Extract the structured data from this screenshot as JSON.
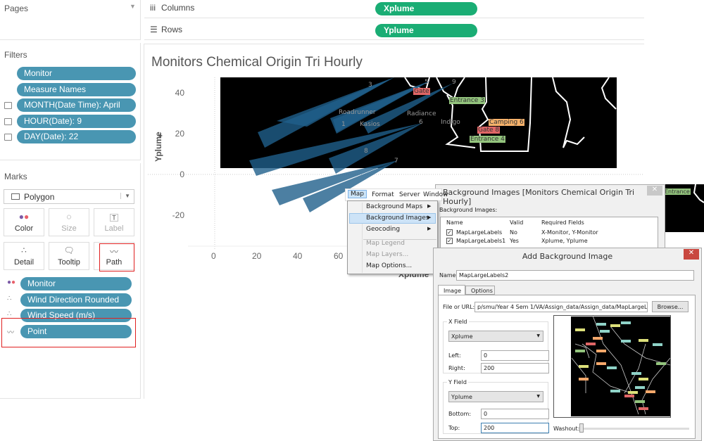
{
  "pages": {
    "title": "Pages"
  },
  "filters": {
    "title": "Filters",
    "items": [
      {
        "label": "Monitor",
        "icon": ""
      },
      {
        "label": "Measure Names",
        "icon": ""
      },
      {
        "label": "MONTH(Date Time): April",
        "icon": "filter-icon"
      },
      {
        "label": "HOUR(Date): 9",
        "icon": "filter-icon"
      },
      {
        "label": "DAY(Date): 22",
        "icon": "filter-icon"
      }
    ]
  },
  "marks": {
    "title": "Marks",
    "type": "Polygon",
    "buttons": [
      {
        "label": "Color",
        "icon": "color-icon",
        "enabled": true
      },
      {
        "label": "Size",
        "icon": "size-icon",
        "enabled": false
      },
      {
        "label": "Label",
        "icon": "label-icon",
        "enabled": false
      },
      {
        "label": "Detail",
        "icon": "detail-icon",
        "enabled": true
      },
      {
        "label": "Tooltip",
        "icon": "tooltip-icon",
        "enabled": true
      },
      {
        "label": "Path",
        "icon": "path-icon",
        "enabled": true
      }
    ],
    "fields": [
      {
        "label": "Monitor",
        "icon": "color-icon"
      },
      {
        "label": "Wind Direction Rounded",
        "icon": "detail-icon"
      },
      {
        "label": "Wind Speed (m/s)",
        "icon": "detail-icon"
      },
      {
        "label": "Point",
        "icon": "path-icon"
      }
    ]
  },
  "shelves": {
    "columns_label": "Columns",
    "columns_pill": "Xplume",
    "rows_label": "Rows",
    "rows_pill": "Yplume"
  },
  "sheet": {
    "title": "Monitors Chemical Origin Tri Hourly",
    "ylabel": "Yplume",
    "xlabel": "Xplume",
    "xticks": [
      "0",
      "20",
      "40",
      "60"
    ],
    "yticks": [
      "40",
      "20",
      "0",
      "-20"
    ],
    "mark_color": "#1f5f8b",
    "map_labels": [
      {
        "t": "Gate",
        "c": "#e06666"
      },
      {
        "t": "Entrance 3",
        "c": "#93c47d"
      },
      {
        "t": "Roadrunner",
        "c": ""
      },
      {
        "t": "Radiance",
        "c": ""
      },
      {
        "t": "Kasios",
        "c": ""
      },
      {
        "t": "Indigo",
        "c": ""
      },
      {
        "t": "Camping 6",
        "c": "#f6b26b"
      },
      {
        "t": "Gate 8",
        "c": "#e06666"
      },
      {
        "t": "Entrance 4",
        "c": "#93c47d"
      },
      {
        "t": "3",
        "c": ""
      },
      {
        "t": "5",
        "c": ""
      },
      {
        "t": "9",
        "c": ""
      },
      {
        "t": "1",
        "c": ""
      },
      {
        "t": "6",
        "c": ""
      },
      {
        "t": "8",
        "c": ""
      },
      {
        "t": "7",
        "c": ""
      },
      {
        "t": "Entrance",
        "c": "#93c47d"
      }
    ]
  },
  "menubar": [
    "Map",
    "Format",
    "Server",
    "Window"
  ],
  "map_menu": [
    {
      "label": "Background Maps",
      "submenu": true,
      "enabled": true
    },
    {
      "label": "Background Images",
      "submenu": true,
      "enabled": true,
      "highlighted": true
    },
    {
      "label": "Geocoding",
      "submenu": true,
      "enabled": true
    },
    {
      "label": "Map Legend",
      "enabled": false
    },
    {
      "label": "Map Layers...",
      "enabled": false
    },
    {
      "label": "Map Options...",
      "enabled": true
    }
  ],
  "bg_dialog": {
    "title": "Background Images [Monitors Chemical Origin Tri Hourly]",
    "section": "Background Images:",
    "columns": [
      "Name",
      "Valid",
      "Required Fields"
    ],
    "rows": [
      {
        "checked": true,
        "name": "MapLargeLabels",
        "valid": "No",
        "fields": "X-Monitor, Y-Monitor"
      },
      {
        "checked": true,
        "name": "MapLargeLabels1",
        "valid": "Yes",
        "fields": "Xplume, Yplume"
      }
    ]
  },
  "add_dialog": {
    "title": "Add Background Image",
    "name_label": "Name:",
    "name_value": "MapLargeLabels2",
    "tabs": [
      "Image",
      "Options"
    ],
    "file_label": "File or URL:",
    "file_value": "p/smu/Year 4 Sem 1/VA/Assign_data/Assign_data/MapLargeLabels.jpg",
    "browse": "Browse...",
    "xfield": {
      "title": "X Field",
      "value": "Xplume",
      "left_label": "Left:",
      "left": "0",
      "right_label": "Right:",
      "right": "200"
    },
    "yfield": {
      "title": "Y Field",
      "value": "Yplume",
      "bottom_label": "Bottom:",
      "bottom": "0",
      "top_label": "Top:",
      "top": "200"
    },
    "washout_label": "Washout:",
    "washout": 0
  }
}
